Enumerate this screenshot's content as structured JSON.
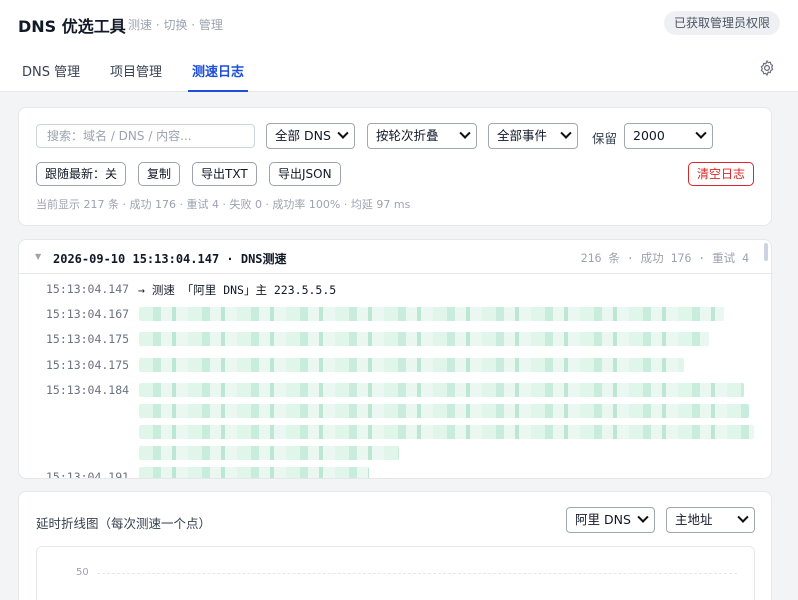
{
  "app": {
    "title": "DNS 优选工具",
    "subtitle": "测速 · 切换 · 管理",
    "admin_badge": "已获取管理员权限"
  },
  "tabs": [
    {
      "label": "DNS 管理",
      "active": false
    },
    {
      "label": "项目管理",
      "active": false
    },
    {
      "label": "测速日志",
      "active": true
    }
  ],
  "icons": {
    "settings": "gear-icon"
  },
  "filters": {
    "search_placeholder": "搜索：域名 / DNS / 内容...",
    "dns_select": "全部 DNS",
    "fold_select": "按轮次折叠",
    "event_select": "全部事件",
    "keep_label": "保留",
    "keep_select": "2000"
  },
  "actions": {
    "follow": "跟随最新：关",
    "copy": "复制",
    "export_txt": "导出TXT",
    "export_json": "导出JSON",
    "clear": "清空日志"
  },
  "stats": "当前显示 217 条 · 成功 176 · 重试 4 · 失败 0 · 成功率 100% · 均延 97 ms",
  "log": {
    "group_title": "2026-09-10 15:13:04.147 · DNS测速",
    "group_meta": "216 条 · 成功 176 · 重试 4",
    "lines": [
      {
        "time": "15:13:04.147",
        "msg": "→ 测速 「阿里 DNS」主 223.5.5.5"
      },
      {
        "time": "15:13:04.167",
        "msg": ""
      },
      {
        "time": "15:13:04.175",
        "msg": ""
      },
      {
        "time": "15:13:04.175",
        "msg": ""
      },
      {
        "time": "15:13:04.184",
        "msg": ""
      },
      {
        "time": "15:13:04.191",
        "msg": ""
      }
    ]
  },
  "chart": {
    "title": "延时折线图（每次测速一个点）",
    "dns_select": "阿里 DNS",
    "addr_select": "主地址",
    "y_tick": "50"
  },
  "colors": {
    "accent": "#1d4ed8",
    "danger": "#dc2626",
    "blur": "#c6ecda"
  }
}
